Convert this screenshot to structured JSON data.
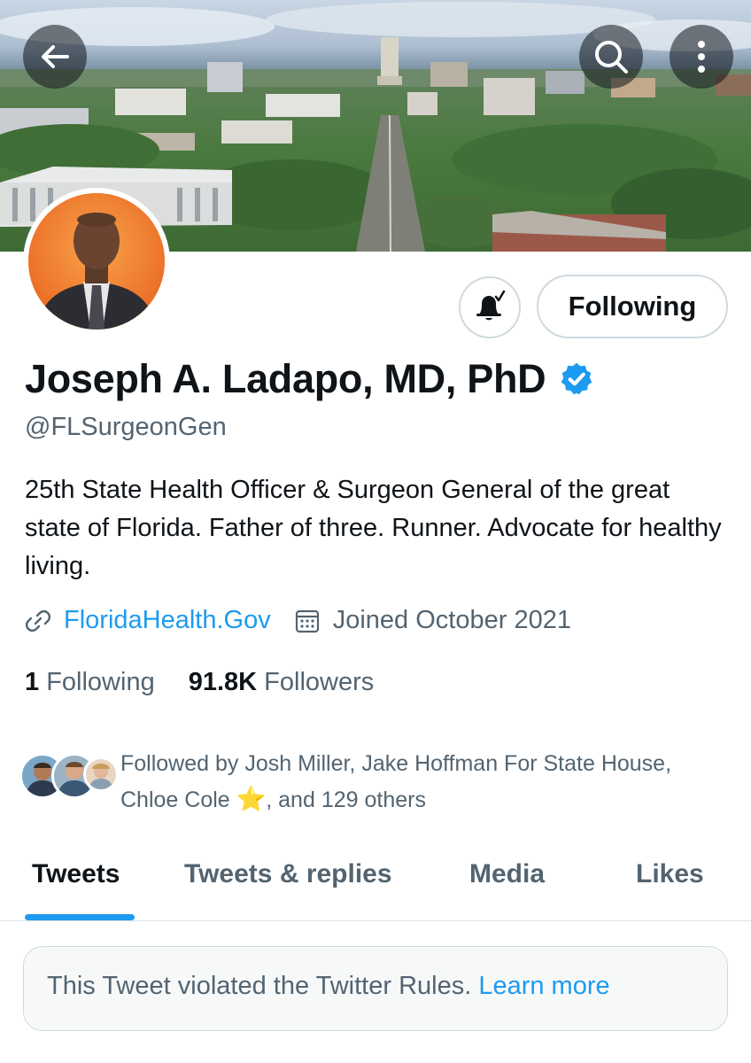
{
  "header": {
    "back_icon": "arrow-left-icon",
    "search_icon": "search-icon",
    "more_icon": "more-vertical-icon"
  },
  "profile": {
    "name": "Joseph A. Ladapo, MD, PhD",
    "handle": "@FLSurgeonGen",
    "bio": "25th State Health Officer & Surgeon General of the great state of Florida. Father of three. Runner. Advocate for healthy living.",
    "website": "FloridaHealth.Gov",
    "joined": "Joined October 2021",
    "verified": true
  },
  "actions": {
    "notifications_icon": "bell-check-icon",
    "follow_label": "Following"
  },
  "stats": {
    "following_count": "1",
    "following_label": "Following",
    "followers_count": "91.8K",
    "followers_label": "Followers"
  },
  "followed_by": {
    "prefix": "Followed by Josh Miller, Jake Hoffman For State House, Chloe Cole",
    "emoji": "⭐",
    "suffix": ", and 129 others"
  },
  "tabs": [
    {
      "label": "Tweets",
      "active": true
    },
    {
      "label": "Tweets & replies",
      "active": false
    },
    {
      "label": "Media",
      "active": false
    },
    {
      "label": "Likes",
      "active": false
    }
  ],
  "notice": {
    "text": "This Tweet violated the Twitter Rules.",
    "link": "Learn more"
  },
  "colors": {
    "accent": "#1d9bf0",
    "text_primary": "#0f1419",
    "text_secondary": "#536471",
    "border": "#cfd9de"
  }
}
